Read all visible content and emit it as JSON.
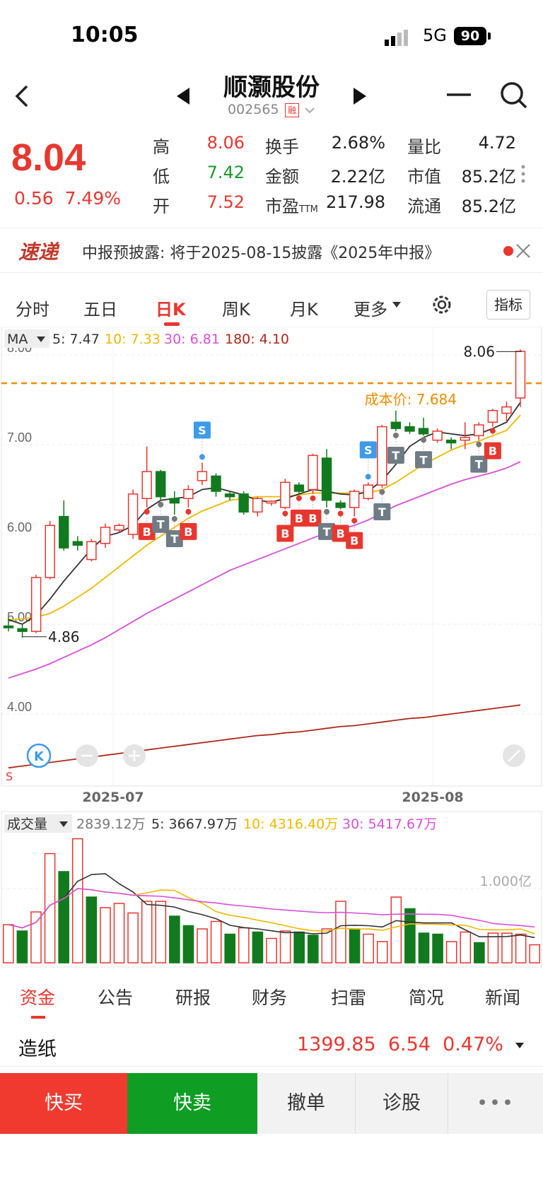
{
  "status": {
    "time": "10:05",
    "network": "5G",
    "battery": "90"
  },
  "header": {
    "name": "顺灏股份",
    "code": "002565",
    "margin_badge": "融"
  },
  "quote": {
    "price": "8.04",
    "change": "0.56",
    "change_pct": "7.49%",
    "fields": [
      {
        "label": "高",
        "value": "8.06",
        "color": "red"
      },
      {
        "label": "换手",
        "value": "2.68%",
        "color": "black"
      },
      {
        "label": "量比",
        "value": "4.72",
        "color": "black"
      },
      {
        "label": "低",
        "value": "7.42",
        "color": "green"
      },
      {
        "label": "金额",
        "value": "2.22亿",
        "color": "black"
      },
      {
        "label": "市值",
        "value": "85.2亿",
        "color": "black"
      },
      {
        "label": "开",
        "value": "7.52",
        "color": "red"
      },
      {
        "label": "市盈TTM",
        "value": "217.98",
        "color": "black"
      },
      {
        "label": "流通",
        "value": "85.2亿",
        "color": "black"
      }
    ]
  },
  "notice": {
    "brand": "速递",
    "text": "中报预披露: 将于2025-08-15披露《2025年中报》"
  },
  "ktabs": {
    "items": [
      "分时",
      "五日",
      "日K",
      "周K",
      "月K",
      "更多"
    ],
    "active": "日K",
    "indicator": "指标"
  },
  "ma_legend": {
    "name": "MA",
    "ma5": "5: 7.47",
    "ma10": "10: 7.33",
    "ma30": "30: 6.81",
    "ma180": "180: 4.10"
  },
  "colors": {
    "up": "#e8372f",
    "down": "#127a1e",
    "ma5": "#333333",
    "ma10": "#f0b800",
    "ma30": "#d94fd9",
    "ma180": "#b02818",
    "cost": "#f08c00"
  },
  "chart_data": [
    {
      "type": "candlestick",
      "title": "",
      "y_ticks": [
        "8.00",
        "7.00",
        "6.00",
        "5.00",
        "4.00"
      ],
      "x_ticks": [
        "2025-07",
        "2025-08"
      ],
      "annotations": {
        "high": "8.06",
        "low": "4.86",
        "cost": "成本价: 7.684",
        "cost_value": 7.684,
        "s_label": "S"
      },
      "ohlc": [
        [
          4.98,
          5.08,
          4.92,
          4.96
        ],
        [
          4.95,
          5.0,
          4.85,
          4.92
        ],
        [
          4.92,
          5.55,
          4.9,
          5.52
        ],
        [
          5.52,
          6.15,
          5.5,
          6.1
        ],
        [
          6.2,
          6.38,
          5.82,
          5.85
        ],
        [
          5.92,
          5.98,
          5.82,
          5.88
        ],
        [
          5.72,
          5.95,
          5.7,
          5.92
        ],
        [
          5.9,
          6.12,
          5.85,
          6.08
        ],
        [
          6.05,
          6.12,
          6.02,
          6.1
        ],
        [
          6.0,
          6.5,
          5.95,
          6.45
        ],
        [
          6.4,
          6.98,
          6.3,
          6.7
        ],
        [
          6.7,
          6.72,
          6.38,
          6.42
        ],
        [
          6.4,
          6.48,
          6.22,
          6.35
        ],
        [
          6.4,
          6.55,
          6.3,
          6.5
        ],
        [
          6.6,
          6.8,
          6.55,
          6.7
        ],
        [
          6.65,
          6.68,
          6.42,
          6.48
        ],
        [
          6.45,
          6.48,
          6.38,
          6.42
        ],
        [
          6.45,
          6.48,
          6.22,
          6.25
        ],
        [
          6.25,
          6.42,
          6.2,
          6.4
        ],
        [
          6.35,
          6.38,
          6.32,
          6.37
        ],
        [
          6.3,
          6.62,
          6.28,
          6.58
        ],
        [
          6.55,
          6.58,
          6.45,
          6.48
        ],
        [
          6.5,
          6.9,
          6.45,
          6.88
        ],
        [
          6.85,
          6.95,
          6.3,
          6.38
        ],
        [
          6.35,
          6.38,
          6.28,
          6.3
        ],
        [
          6.3,
          6.5,
          6.2,
          6.48
        ],
        [
          6.4,
          6.58,
          6.38,
          6.55
        ],
        [
          6.55,
          7.22,
          6.52,
          7.2
        ],
        [
          7.25,
          7.38,
          7.15,
          7.18
        ],
        [
          7.2,
          7.25,
          7.12,
          7.15
        ],
        [
          7.18,
          7.3,
          7.1,
          7.12
        ],
        [
          7.05,
          7.18,
          7.02,
          7.15
        ],
        [
          7.05,
          7.08,
          6.95,
          7.02
        ],
        [
          7.05,
          7.25,
          6.95,
          7.08
        ],
        [
          7.1,
          7.25,
          7.05,
          7.22
        ],
        [
          7.25,
          7.4,
          7.2,
          7.38
        ],
        [
          7.35,
          7.48,
          7.25,
          7.42
        ],
        [
          7.52,
          8.06,
          7.42,
          8.04
        ]
      ],
      "ma5": [
        5.05,
        5.0,
        5.1,
        5.28,
        5.48,
        5.66,
        5.84,
        5.98,
        6.02,
        6.1,
        6.28,
        6.38,
        6.4,
        6.42,
        6.5,
        6.52,
        6.48,
        6.44,
        6.38,
        6.36,
        6.4,
        6.45,
        6.5,
        6.48,
        6.45,
        6.44,
        6.48,
        6.6,
        6.78,
        6.98,
        7.08,
        7.14,
        7.12,
        7.1,
        7.12,
        7.18,
        7.25,
        7.47
      ],
      "ma10": [
        5.05,
        5.06,
        5.08,
        5.12,
        5.2,
        5.3,
        5.4,
        5.52,
        5.64,
        5.76,
        5.88,
        5.98,
        6.08,
        6.18,
        6.26,
        6.32,
        6.38,
        6.4,
        6.42,
        6.42,
        6.42,
        6.44,
        6.46,
        6.46,
        6.46,
        6.46,
        6.46,
        6.5,
        6.58,
        6.68,
        6.78,
        6.86,
        6.94,
        7.0,
        7.04,
        7.1,
        7.16,
        7.33
      ],
      "ma30": [
        4.4,
        4.45,
        4.5,
        4.56,
        4.63,
        4.7,
        4.77,
        4.85,
        4.94,
        5.03,
        5.12,
        5.2,
        5.28,
        5.36,
        5.44,
        5.52,
        5.6,
        5.66,
        5.72,
        5.78,
        5.84,
        5.9,
        5.96,
        6.02,
        6.06,
        6.1,
        6.16,
        6.24,
        6.32,
        6.38,
        6.44,
        6.5,
        6.56,
        6.61,
        6.65,
        6.69,
        6.74,
        6.81
      ],
      "ma180": [
        3.4,
        3.42,
        3.44,
        3.46,
        3.48,
        3.5,
        3.52,
        3.54,
        3.56,
        3.58,
        3.6,
        3.62,
        3.64,
        3.66,
        3.68,
        3.7,
        3.72,
        3.74,
        3.76,
        3.77,
        3.79,
        3.8,
        3.82,
        3.84,
        3.86,
        3.87,
        3.89,
        3.91,
        3.93,
        3.95,
        3.96,
        3.98,
        4.0,
        4.02,
        4.04,
        4.06,
        4.08,
        4.1
      ],
      "signals": [
        {
          "i": 10,
          "t": "B"
        },
        {
          "i": 11,
          "t": "T"
        },
        {
          "i": 12,
          "t": "T"
        },
        {
          "i": 13,
          "t": "B"
        },
        {
          "i": 14,
          "t": "S"
        },
        {
          "i": 20,
          "t": "B"
        },
        {
          "i": 21,
          "t": "B"
        },
        {
          "i": 22,
          "t": "B"
        },
        {
          "i": 23,
          "t": "T"
        },
        {
          "i": 24,
          "t": "B"
        },
        {
          "i": 25,
          "t": "B"
        },
        {
          "i": 26,
          "t": "S"
        },
        {
          "i": 27,
          "t": "T"
        },
        {
          "i": 28,
          "t": "T"
        },
        {
          "i": 30,
          "t": "T"
        },
        {
          "i": 34,
          "t": "T"
        },
        {
          "i": 35,
          "t": "B"
        }
      ]
    },
    {
      "type": "bar",
      "title": "成交量",
      "label_last": "2839.12万",
      "ma5": "5: 3667.97万",
      "ma10": "10: 4316.40万",
      "ma30": "30: 5417.67万",
      "ref_label": "1.000亿",
      "values": [
        3600,
        3000,
        4800,
        10300,
        8600,
        11700,
        6200,
        5200,
        5600,
        4700,
        5800,
        5800,
        4400,
        3500,
        3200,
        3900,
        2700,
        3300,
        2900,
        2300,
        3000,
        2900,
        2600,
        3200,
        5800,
        3200,
        2700,
        2000,
        6200,
        5100,
        2800,
        2700,
        2000,
        2900,
        1900,
        2800,
        2800,
        2700,
        1700
      ],
      "up": [
        1,
        0,
        1,
        1,
        0,
        1,
        0,
        1,
        1,
        1,
        1,
        1,
        0,
        0,
        1,
        1,
        0,
        1,
        0,
        1,
        1,
        0,
        0,
        1,
        1,
        0,
        1,
        1,
        1,
        0,
        0,
        0,
        1,
        1,
        0,
        1,
        1,
        1,
        1
      ]
    }
  ],
  "bottom_tabs": {
    "items": [
      "资金",
      "公告",
      "研报",
      "财务",
      "扫雷",
      "简况",
      "新闻"
    ],
    "active": "资金"
  },
  "industry": {
    "name": "造纸",
    "value": "1399.85",
    "change": "6.54",
    "pct": "0.47%"
  },
  "actions": {
    "buy": "快买",
    "sell": "快卖",
    "cancel": "撤单",
    "diagnose": "诊股",
    "more": "•••"
  }
}
